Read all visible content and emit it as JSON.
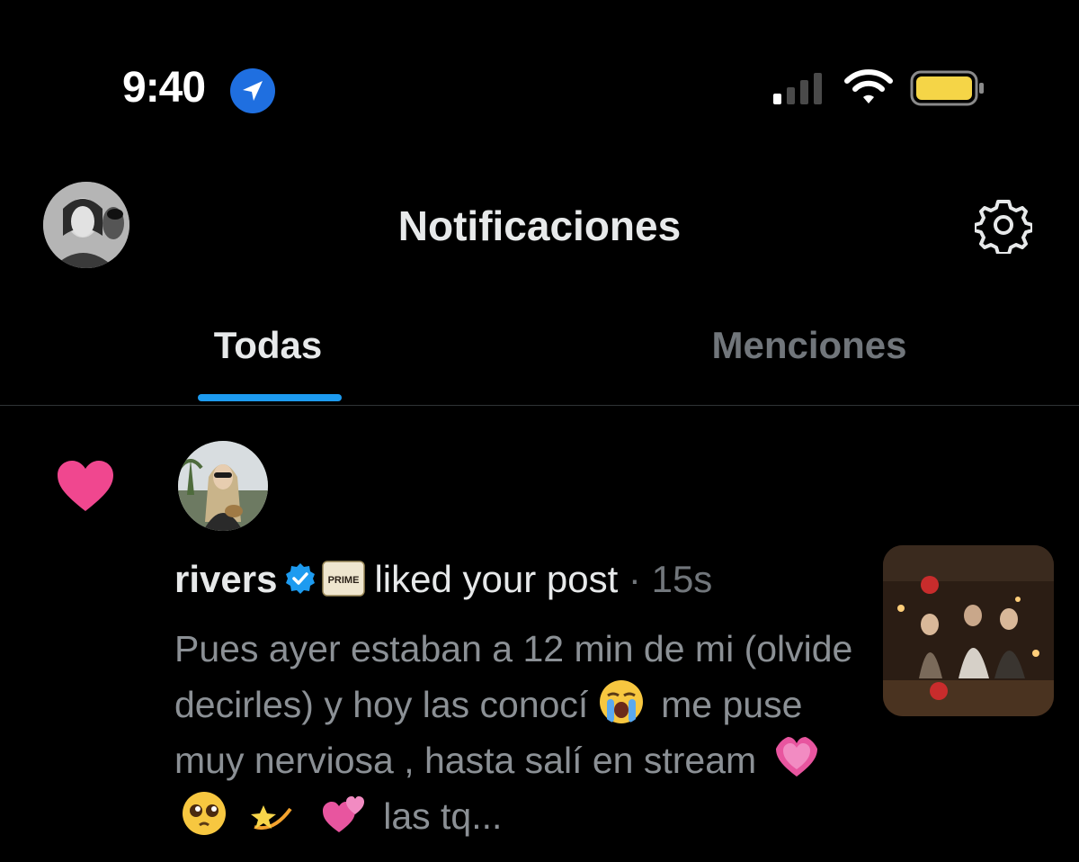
{
  "status_bar": {
    "time": "9:40",
    "location_icon": "location-arrow-icon",
    "signal_icon": "cellular-signal-icon",
    "wifi_icon": "wifi-icon",
    "battery_icon": "battery-icon",
    "battery_color": "#f5d547"
  },
  "header": {
    "title": "Notificaciones",
    "settings_icon": "gear-icon"
  },
  "tabs": [
    {
      "label": "Todas",
      "active": true
    },
    {
      "label": "Menciones",
      "active": false
    }
  ],
  "colors": {
    "accent": "#1d9bf0",
    "like": "#f0478f",
    "verified": "#1d9bf0",
    "muted": "#71767b"
  },
  "notification": {
    "type_icon": "heart-icon",
    "user": "rivers",
    "verified_icon": "verified-badge-icon",
    "badge_label": "PRIME",
    "action": "liked your post",
    "separator": "·",
    "time": "15s",
    "post_text_1": "Pues ayer estaban a 12 min de mi (olvide decirles) y hoy las conocí",
    "emoji_1": "😭",
    "post_text_2": "me puse muy nerviosa , hasta salí en stream",
    "emoji_2": "💗",
    "emoji_3": "🥹",
    "emoji_4": "💫",
    "emoji_5": "💞",
    "post_text_3": "las tq..."
  }
}
